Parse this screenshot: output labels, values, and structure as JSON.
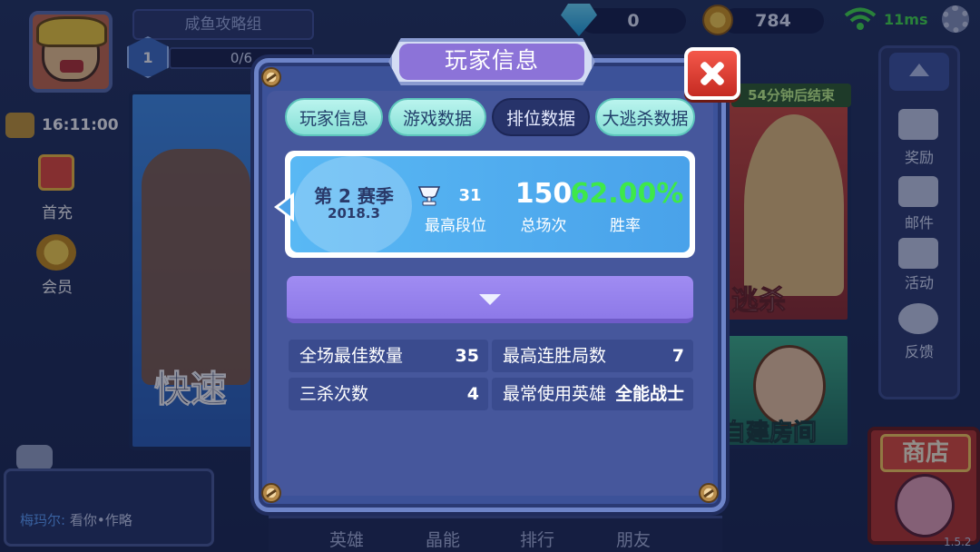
{
  "top": {
    "guild_name": "咸鱼攻略组",
    "level": "1",
    "exp": "0/6",
    "gems": "0",
    "coins": "784",
    "ping": "11ms",
    "colors": {
      "ping": "#43e04a",
      "gem": "#1fa3e0",
      "coin": "#ffd34d"
    }
  },
  "left_side": {
    "time": "16:11:00",
    "first_recharge": "首充",
    "member": "会员"
  },
  "modes": {
    "left_label": "快速",
    "right_top_label": "逃杀",
    "right_top_timer": "54分钟后结束",
    "right_bottom_label": "自建房间"
  },
  "right_rail": {
    "items": [
      {
        "label": "奖励",
        "icon": "money-bag-icon"
      },
      {
        "label": "邮件",
        "icon": "mail-icon"
      },
      {
        "label": "活动",
        "icon": "flag-icon"
      },
      {
        "label": "反馈",
        "icon": "headset-icon"
      }
    ]
  },
  "shop": {
    "label": "商店"
  },
  "version": "1.5.2",
  "chat": {
    "sender": "梅玛尔:",
    "message": "看你•作略"
  },
  "bottom_nav": [
    "英雄",
    "晶能",
    "排行",
    "朋友"
  ],
  "modal": {
    "title": "玩家信息",
    "tabs": [
      {
        "label": "玩家信息",
        "active": false
      },
      {
        "label": "游戏数据",
        "active": false
      },
      {
        "label": "排位数据",
        "active": true
      },
      {
        "label": "大逃杀数据",
        "active": false
      }
    ],
    "season": {
      "name": "第 2 赛季",
      "date": "2018.3",
      "best_rank_value": "31",
      "best_rank_label": "最高段位",
      "total_games_value": "150",
      "total_games_label": "总场次",
      "win_rate_value": "62.00%",
      "win_rate_label": "胜率",
      "colors": {
        "win_rate": "#3ee84a"
      }
    },
    "stats": [
      {
        "label": "全场最佳数量",
        "value": "35"
      },
      {
        "label": "最高连胜局数",
        "value": "7"
      },
      {
        "label": "三杀次数",
        "value": "4"
      },
      {
        "label": "最常使用英雄",
        "value": "全能战士"
      }
    ]
  }
}
